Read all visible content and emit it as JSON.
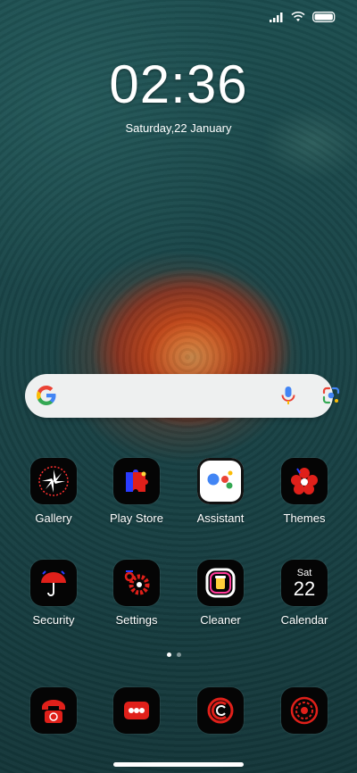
{
  "status_bar": {
    "icons": [
      "signal-icon",
      "wifi-icon",
      "battery-icon"
    ]
  },
  "lock": {
    "time": "02:36",
    "date": "Saturday,22 January"
  },
  "search_bar": {
    "icons": [
      "google-g-icon",
      "microphone-icon",
      "google-lens-icon"
    ]
  },
  "apps_row1": [
    {
      "label": "Gallery"
    },
    {
      "label": "Play Store"
    },
    {
      "label": "Assistant"
    },
    {
      "label": "Themes"
    }
  ],
  "apps_row2": [
    {
      "label": "Security"
    },
    {
      "label": "Settings"
    },
    {
      "label": "Cleaner"
    },
    {
      "label": "Calendar",
      "day": "Sat",
      "date": "22"
    }
  ],
  "page_indicator": {
    "pages": 2,
    "current": 1
  },
  "dock": {
    "icons": [
      "phone-icon",
      "messages-icon",
      "browser-icon",
      "camera-icon"
    ]
  },
  "colors": {
    "accent_red": "#ff2a2a",
    "accent_blue": "#2a3cff",
    "search_bg": "#eef0f0"
  }
}
